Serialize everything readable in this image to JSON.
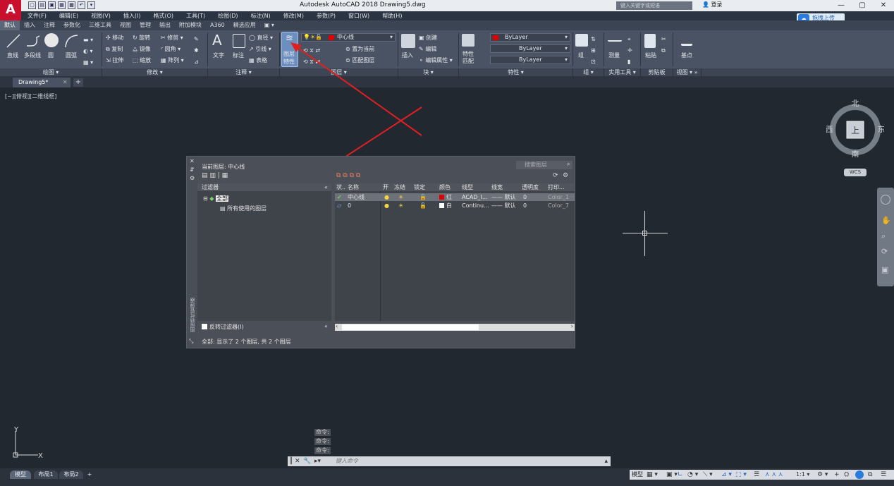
{
  "app": {
    "logo": "A",
    "title": "Autodesk AutoCAD 2018    Drawing5.dwg",
    "search_placeholder": "键入关键字或短语",
    "login": "登录",
    "upload": "拖拽上传",
    "window_controls": [
      "—",
      "▢",
      "✕"
    ]
  },
  "menu": [
    "文件(F)",
    "编辑(E)",
    "视图(V)",
    "插入(I)",
    "格式(O)",
    "工具(T)",
    "绘图(D)",
    "标注(N)",
    "修改(M)",
    "参数(P)",
    "窗口(W)",
    "帮助(H)"
  ],
  "ribbon_tabs": [
    "默认",
    "插入",
    "注释",
    "参数化",
    "三维工具",
    "视图",
    "管理",
    "输出",
    "附加模块",
    "A360",
    "精选应用",
    "▣ ▾"
  ],
  "ribbon": {
    "draw_tools": [
      "直线",
      "多段线",
      "圆",
      "圆弧"
    ],
    "modify_tools": [
      "移动",
      "旋转",
      "修剪",
      "复制",
      "镜像",
      "圆角",
      "拉伸",
      "缩放",
      "阵列"
    ],
    "annotation_tools": [
      "文字",
      "标注",
      "直径",
      "引线",
      "表格"
    ],
    "layer_props": "图层\n特性",
    "layer_props_line1": "图层",
    "layer_props_line2": "特性",
    "layer_combo": "中心线",
    "layer_tools": [
      "置为当前",
      "匹配图层"
    ],
    "insert": "插入",
    "block_tools": [
      "创建",
      "编辑",
      "编辑属性"
    ],
    "match_props": "特性\n匹配",
    "match_props_line1": "特性",
    "match_props_line2": "匹配",
    "bylayer_color": "ByLayer",
    "bylayer_linetype": "ByLayer",
    "bylayer_lineweight": "ByLayer",
    "group": "组",
    "measure": "测量",
    "paste": "粘贴",
    "base": "基点",
    "panels": [
      "绘图 ▾",
      "修改 ▾",
      "注释 ▾",
      "图层 ▾",
      "块 ▾",
      "特性 ▾",
      "组 ▾",
      "实用工具 ▾",
      "剪贴板",
      "视图 ▾ »"
    ]
  },
  "file_tab": "Drawing5*",
  "viewport_label": "[−][俯视][二维线框]",
  "viewcube": {
    "north": "北",
    "south": "南",
    "east": "东",
    "west": "西",
    "top": "上",
    "wcs": "WCS"
  },
  "layer_manager": {
    "current_layer": "当前图层: 中心线",
    "search_placeholder": "搜索图层",
    "filters_header": "过滤器",
    "filter_all": "全部",
    "filter_used": "所有使用的图层",
    "invert_filter": "反转过滤器(I)",
    "side_title": "图层特性管理器",
    "columns": [
      "状..",
      "名称",
      "开",
      "冻结",
      "锁定",
      "颜色",
      "线型",
      "线宽",
      "透明度",
      "打印..."
    ],
    "rows": [
      {
        "status": "✔",
        "name": "中心线",
        "on": "●",
        "freeze": "☀",
        "lock": "🔓",
        "color_name": "红",
        "color": "#e00000",
        "linetype": "ACAD_I...",
        "lineweight": "—— 默认",
        "transparency": "0",
        "plot": "Color_1"
      },
      {
        "status": "▱",
        "name": "0",
        "on": "●",
        "freeze": "☀",
        "lock": "🔓",
        "color_name": "白",
        "color": "#ffffff",
        "linetype": "Continu...",
        "lineweight": "—— 默认",
        "transparency": "0",
        "plot": "Color_7"
      }
    ],
    "summary": "全部: 显示了 2 个图层, 共 2 个图层"
  },
  "command": {
    "history": [
      "命令:",
      "命令:",
      "命令:"
    ],
    "placeholder": "键入命令"
  },
  "layout_tabs": [
    "模型",
    "布局1",
    "布局2",
    "+"
  ],
  "status_model": "模型",
  "ucs": {
    "x": "X",
    "y": "Y"
  }
}
